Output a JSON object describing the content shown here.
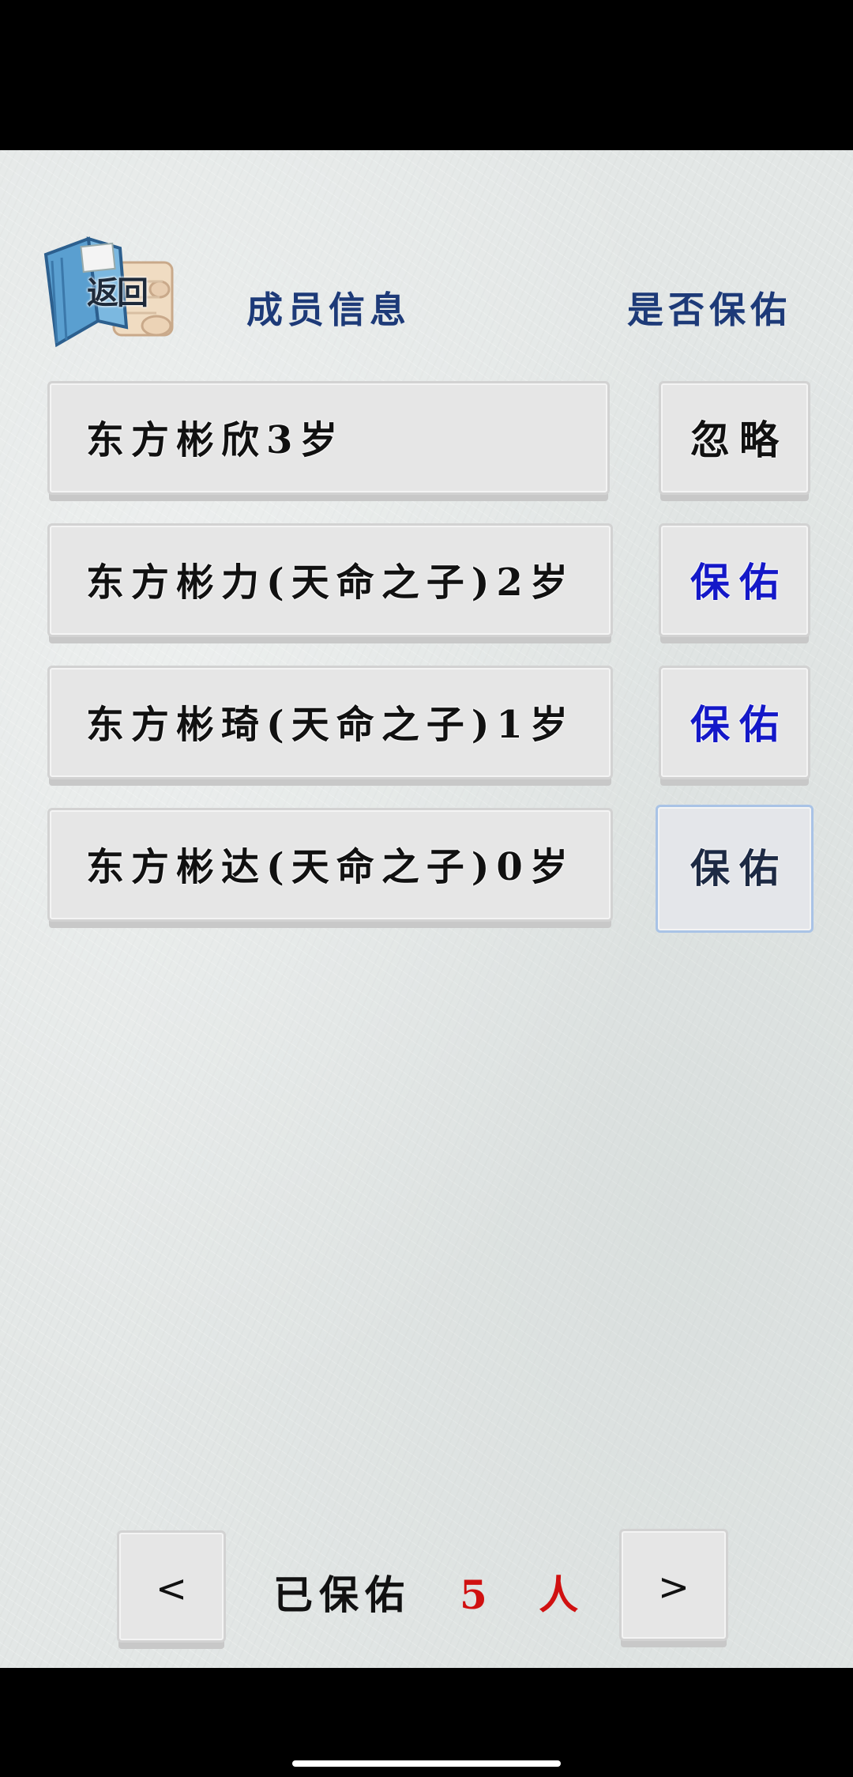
{
  "header": {
    "back_label": "返回",
    "member_info": "成员信息",
    "bless_question": "是否保佑"
  },
  "members": [
    {
      "name": "东方彬欣3岁",
      "action": "忽略"
    },
    {
      "name": "东方彬力(天命之子)2岁",
      "action": "保佑"
    },
    {
      "name": "东方彬琦(天命之子)1岁",
      "action": "保佑"
    },
    {
      "name": "东方彬达(天命之子)0岁",
      "action": "保佑"
    }
  ],
  "footer": {
    "prev": "<",
    "next": ">",
    "blessed_label": "已保佑",
    "blessed_count": "5 人"
  },
  "colors": {
    "header_text": "#1d3a78",
    "bless_action": "#1418c8",
    "count_red": "#d01010",
    "selected_border": "#a9c3e6"
  },
  "icons": {
    "back": "scroll-book-icon"
  }
}
